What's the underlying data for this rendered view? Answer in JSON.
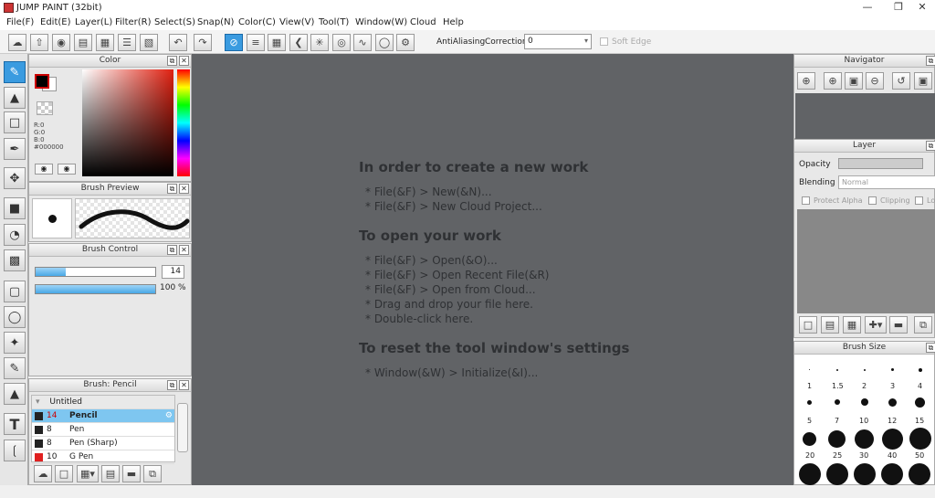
{
  "window": {
    "title": "JUMP PAINT (32bit)",
    "minimize": "—",
    "restore": "❐",
    "close": "✕"
  },
  "menu": [
    "File(F)",
    "Edit(E)",
    "Layer(L)",
    "Filter(R)",
    "Select(S)",
    "Snap(N)",
    "Color(C)",
    "View(V)",
    "Tool(T)",
    "Window(W)",
    "Cloud",
    "Help"
  ],
  "toolbar": {
    "antialias_label": "AntiAliasing",
    "correction_label": "Correction",
    "correction_value": "0",
    "soft_edge_label": "Soft Edge"
  },
  "color_panel": {
    "title": "Color",
    "r": "R:0",
    "g": "G:0",
    "b": "B:0",
    "hex": "#000000",
    "fg_color": "#000000",
    "bg_color": "#ffffff"
  },
  "brush_preview": {
    "title": "Brush Preview"
  },
  "brush_control": {
    "title": "Brush Control",
    "size_value": "14",
    "size_fraction": 0.25,
    "opacity_value": "100 %",
    "opacity_fraction": 1.0
  },
  "brush_list": {
    "title": "Brush: Pencil",
    "group": "Untitled",
    "items": [
      {
        "size": "14",
        "name": "Pencil",
        "color": "#222222",
        "selected": true
      },
      {
        "size": "8",
        "name": "Pen",
        "color": "#222222",
        "selected": false
      },
      {
        "size": "8",
        "name": "Pen (Sharp)",
        "color": "#222222",
        "selected": false
      },
      {
        "size": "10",
        "name": "G Pen",
        "color": "#e02020",
        "selected": false
      }
    ]
  },
  "canvas": {
    "background": "#616366",
    "sections": [
      {
        "heading": "In order to create a new work",
        "items": [
          "* File(&F) > New(&N)...",
          "* File(&F) > New Cloud Project..."
        ]
      },
      {
        "heading": "To open your work",
        "items": [
          "* File(&F) > Open(&O)...",
          "* File(&F) > Open Recent File(&R)",
          "* File(&F) > Open from Cloud...",
          "* Drag and drop your file here.",
          "* Double-click here."
        ]
      },
      {
        "heading": "To reset the tool window's settings",
        "items": [
          "* Window(&W) > Initialize(&I)..."
        ]
      }
    ]
  },
  "navigator": {
    "title": "Navigator"
  },
  "layer": {
    "title": "Layer",
    "opacity_label": "Opacity",
    "blending_label": "Blending",
    "blending_value": "Normal",
    "protect_alpha": "Protect Alpha",
    "clipping": "Clipping",
    "lock": "Lo"
  },
  "brush_size": {
    "title": "Brush Size",
    "row_labels": [
      [
        "1",
        "1.5",
        "2",
        "3",
        "4"
      ],
      [
        "5",
        "7",
        "10",
        "12",
        "15"
      ],
      [
        "20",
        "25",
        "30",
        "40",
        "50"
      ]
    ]
  },
  "accent": "#3a9be0"
}
